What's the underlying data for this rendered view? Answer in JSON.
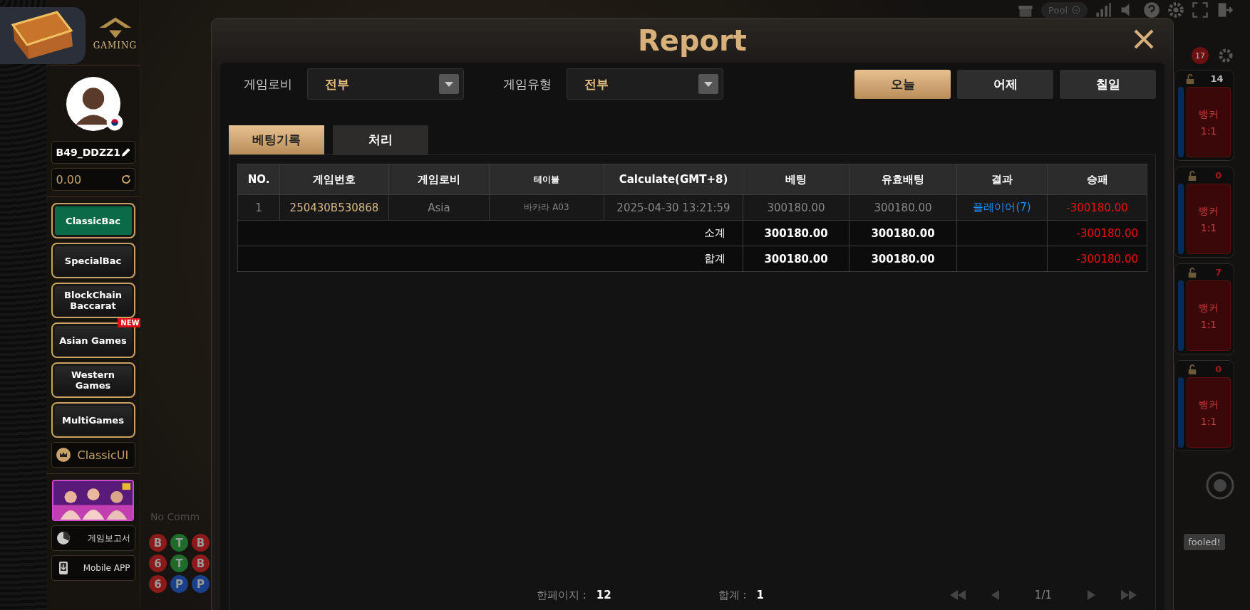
{
  "sidebar": {
    "brand": "GAMING",
    "username": "B49_DDZZ1",
    "balance": "0.00",
    "menu": [
      {
        "label": "ClassicBac",
        "selected": true
      },
      {
        "label": "SpecialBac",
        "selected": false
      },
      {
        "label": "BlockChain Baccarat",
        "selected": false
      },
      {
        "label": "Asian Games",
        "selected": false,
        "badge": "NEW"
      },
      {
        "label": "Western Games",
        "selected": false
      },
      {
        "label": "MultiGames",
        "selected": false
      }
    ],
    "classic_ui": "ClassicUI",
    "links": [
      {
        "label": "게임보고서",
        "kind": "report"
      },
      {
        "label": "Mobile APP",
        "kind": "mobile"
      }
    ]
  },
  "background": {
    "pool": "Pool",
    "notification_count": "17",
    "no_comm": "No Comm",
    "bead_road": [
      [
        {
          "letter": "B",
          "color": "#8b1a1a"
        },
        {
          "letter": "T",
          "color": "#1f6b2a"
        },
        {
          "letter": "B",
          "color": "#8b1a1a"
        }
      ],
      [
        {
          "letter": "6",
          "color": "#8b1a1a"
        },
        {
          "letter": "T",
          "color": "#1f6b2a"
        },
        {
          "letter": "B",
          "color": "#8b1a1a"
        }
      ],
      [
        {
          "letter": "6",
          "color": "#8b1a1a"
        },
        {
          "letter": "P",
          "color": "#1a3f8b"
        },
        {
          "letter": "P",
          "color": "#1a3f8b"
        }
      ]
    ],
    "tables": [
      {
        "count": "14",
        "color": "#b8b8b8",
        "bet": "뱅커",
        "odds": "1:1"
      },
      {
        "count": "0",
        "color": "#a01818",
        "bet": "뱅커",
        "odds": "1:1"
      },
      {
        "count": "7",
        "color": "#a01818",
        "bet": "뱅커",
        "odds": "1:1"
      },
      {
        "count": "0",
        "color": "#a01818",
        "bet": "뱅커",
        "odds": "1:1"
      }
    ],
    "chat": "fooled!"
  },
  "modal": {
    "title": "Report",
    "filters": [
      {
        "label": "게임로비",
        "value": "전부"
      },
      {
        "label": "게임유형",
        "value": "전부"
      }
    ],
    "date_buttons": [
      {
        "label": "오늘",
        "selected": true
      },
      {
        "label": "어제",
        "selected": false
      },
      {
        "label": "칠일",
        "selected": false
      }
    ],
    "tabs": [
      {
        "label": "베팅기록",
        "selected": true
      },
      {
        "label": "처리",
        "selected": false
      }
    ],
    "table": {
      "columns": [
        "NO.",
        "게임번호",
        "게임로비",
        "테이블",
        "Calculate(GMT+8)",
        "베팅",
        "유효배팅",
        "결과",
        "승패"
      ],
      "rows": [
        [
          "1",
          "250430B530868",
          "Asia",
          "바카라 A03",
          "2025-04-30 13:21:59",
          "300180.00",
          "300180.00",
          "플레이어(7)",
          "-300180.00"
        ]
      ],
      "summary": [
        {
          "label": "소계",
          "bet": "300180.00",
          "valid_bet": "300180.00",
          "win_loss": "-300180.00"
        },
        {
          "label": "합계",
          "bet": "300180.00",
          "valid_bet": "300180.00",
          "win_loss": "-300180.00"
        }
      ]
    },
    "pagination": {
      "page_size_label": "한페이지 :",
      "page_size": "12",
      "total_label": "합계 :",
      "total": "1",
      "page": "1/1"
    }
  }
}
